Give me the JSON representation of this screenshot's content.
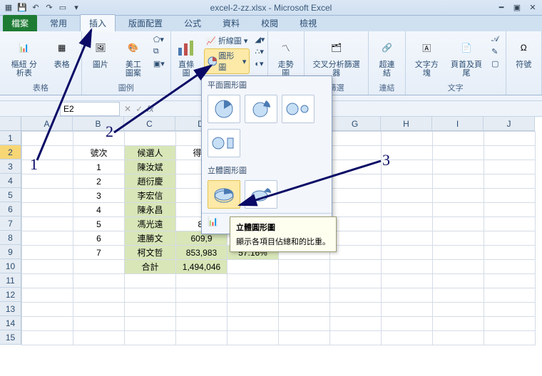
{
  "title": "excel-2-zz.xlsx - Microsoft Excel",
  "qa_tools": [
    "save-icon",
    "undo-icon",
    "redo-icon",
    "doc-icon",
    "down-icon"
  ],
  "tabs": {
    "file": "檔案",
    "items": [
      "常用",
      "插入",
      "版面配置",
      "公式",
      "資料",
      "校閱",
      "檢視"
    ],
    "active_index": 1
  },
  "ribbon": {
    "groups": {
      "tables": {
        "pivot": "樞紐\n分析表",
        "table": "表格",
        "label": "表格"
      },
      "illus": {
        "picture": "圖片",
        "clipart": "美工圖案",
        "label": "圖例"
      },
      "charts": {
        "column": "直條圖",
        "line": "折線圖",
        "pie": "圓形圖",
        "label": "圖表"
      },
      "sparklines": {
        "btn": "走勢圖",
        "label": ""
      },
      "filter": {
        "btn": "交叉分析篩選器",
        "label": "篩選"
      },
      "links": {
        "btn": "超連結",
        "label": "連結"
      },
      "text": {
        "textbox": "文字方塊",
        "headerfooter": "頁首及頁尾",
        "label": "文字"
      },
      "symbols": {
        "btn": "符號",
        "label": ""
      }
    }
  },
  "dropdown": {
    "section1": "平面圓形圖",
    "section2": "立體圓形圖",
    "footer_icon": "chart-icon",
    "tooltip": {
      "title": "立體圓形圖",
      "body": "顯示各項目佔總和的比重。"
    }
  },
  "namebox": "E2",
  "columns": [
    "A",
    "B",
    "C",
    "D",
    "E",
    "F",
    "G",
    "H",
    "I",
    "J"
  ],
  "rows_shown": 15,
  "sheet": {
    "headers_row": 2,
    "B": [
      "",
      "號次",
      "1",
      "2",
      "3",
      "4",
      "5",
      "6",
      "7",
      ""
    ],
    "C": [
      "",
      "候選人",
      "陳汝斌",
      "趙衍慶",
      "李宏信",
      "陳永昌",
      "馮光遠",
      "連勝文",
      "柯文哲",
      "合計"
    ],
    "D": [
      "",
      "得票",
      "",
      "",
      "",
      "",
      "8,",
      "609,9",
      "853,983",
      "1,494,046"
    ],
    "E": [
      "",
      "",
      "",
      "",
      "",
      "",
      "",
      "",
      "57.16%",
      ""
    ]
  },
  "annotations": {
    "n1": "1",
    "n2": "2",
    "n3": "3"
  }
}
